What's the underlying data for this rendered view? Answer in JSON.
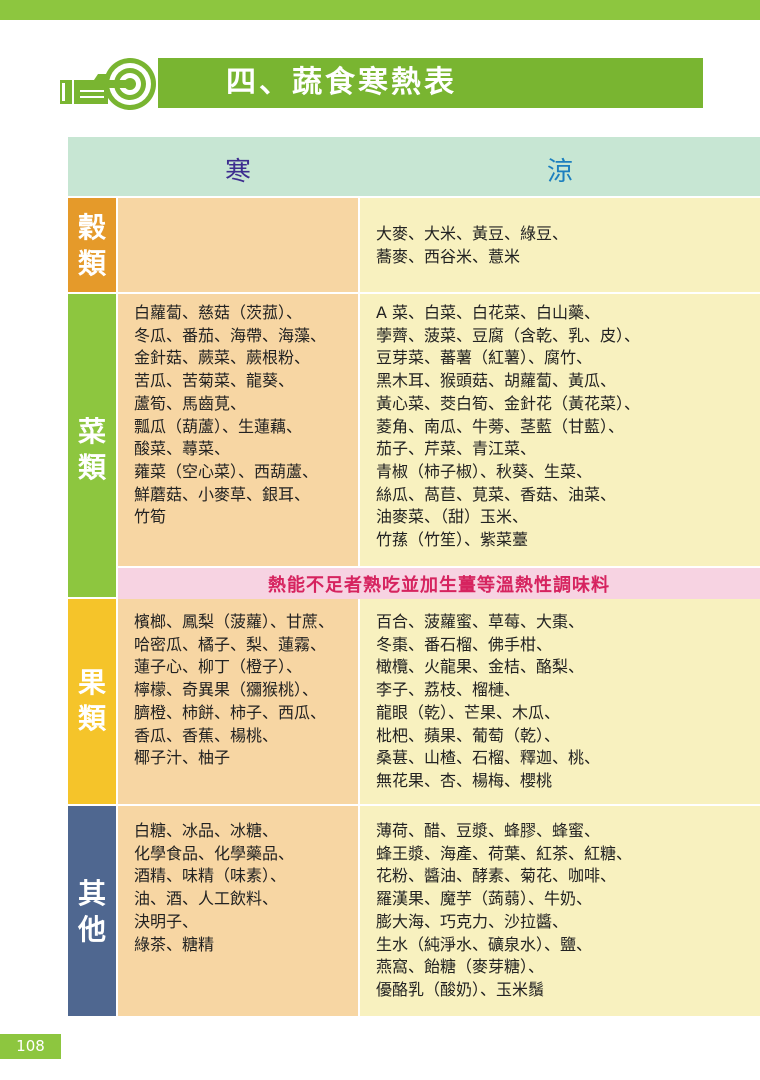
{
  "title": "四、蔬食寒熱表",
  "header": {
    "cold": "寒",
    "cool": "涼"
  },
  "categories": [
    {
      "label": "穀類",
      "chars": [
        "穀",
        "類"
      ],
      "color": "#e59a2a",
      "cold_lines": [],
      "cool_lines": [
        "大麥、大米、黃豆、綠豆、",
        "蕎麥、西谷米、薏米"
      ]
    },
    {
      "label": "菜類",
      "chars": [
        "菜",
        "類"
      ],
      "color": "#8dc63f",
      "cold_lines": [
        "白蘿蔔、慈菇（茨菰）、",
        "冬瓜、番茄、海帶、海藻、",
        "金針菇、蕨菜、蕨根粉、",
        "苦瓜、苦菊菜、龍葵、",
        "蘆筍、馬齒莧、",
        "瓢瓜（葫蘆）、生蓮藕、",
        "酸菜、蕁菜、",
        "蕹菜（空心菜）、西葫蘆、",
        "鮮蘑菇、小麥草、銀耳、",
        "竹筍"
      ],
      "cool_lines": [
        "A 菜、白菜、白花菜、白山藥、",
        "荸薺、菠菜、豆腐（含乾、乳、皮）、",
        "豆芽菜、蕃薯（紅薯）、腐竹、",
        "黑木耳、猴頭菇、胡蘿蔔、黃瓜、",
        "黃心菜、茭白筍、金針花（黃花菜）、",
        "菱角、南瓜、牛蒡、茎藍（甘藍）、",
        "茄子、芹菜、青江菜、",
        "青椒（柿子椒）、秋葵、生菜、",
        "絲瓜、萵苣、莧菜、香菇、油菜、",
        "油麥菜、（甜）玉米、",
        "竹蓀（竹笙）、紫菜薹"
      ]
    },
    {
      "label": "果類",
      "chars": [
        "果",
        "類"
      ],
      "color": "#f5c42a",
      "cold_lines": [
        "檳榔、鳳梨（菠蘿）、甘蔗、",
        "哈密瓜、橘子、梨、蓮霧、",
        "蓮子心、柳丁（橙子）、",
        "檸檬、奇異果（獼猴桃）、",
        "臍橙、柿餅、柿子、西瓜、",
        "香瓜、香蕉、楊桃、",
        "椰子汁、柚子"
      ],
      "cool_lines": [
        "百合、菠蘿蜜、草莓、大棗、",
        "冬棗、番石榴、佛手柑、",
        "橄欖、火龍果、金桔、酪梨、",
        "李子、荔枝、榴槤、",
        "龍眼（乾）、芒果、木瓜、",
        "枇杷、蘋果、葡萄（乾）、",
        "桑葚、山楂、石榴、釋迦、桃、",
        "無花果、杏、楊梅、櫻桃"
      ]
    },
    {
      "label": "其他",
      "chars": [
        "其",
        "他"
      ],
      "color": "#4f6790",
      "cold_lines": [
        "白糖、冰品、冰糖、",
        "化學食品、化學藥品、",
        "酒精、味精（味素）、",
        "油、酒、人工飲料、",
        "決明子、",
        "綠茶、糖精"
      ],
      "cool_lines": [
        "薄荷、醋、豆漿、蜂膠、蜂蜜、",
        "蜂王漿、海產、荷葉、紅茶、紅糖、",
        "花粉、醬油、酵素、菊花、咖啡、",
        "羅漢果、魔芋（蒟蒻）、牛奶、",
        "膨大海、巧克力、沙拉醬、",
        "生水（純淨水、礦泉水）、鹽、",
        "燕窩、飴糖（麥芽糖）、",
        "優酪乳（酸奶）、玉米鬚"
      ]
    }
  ],
  "note": "熱能不足者熟吃並加生薑等溫熱性調味料",
  "page_number": "108",
  "colors": {
    "top_bar": "#8dc63f",
    "title_bar": "#79b531",
    "header_bg": "#c7e6d3",
    "cold_bg": "#f7d6a3",
    "cool_bg": "#f8f1bf",
    "note_bg": "#f7d3e2",
    "note_text": "#d6235f"
  }
}
